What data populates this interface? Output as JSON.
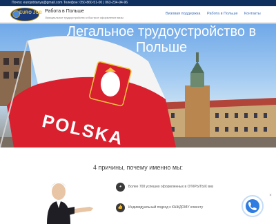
{
  "topbar": {
    "contacts": "Почта: eurojobtanya@gmail.com Телефон: 050-860-51-00 | 063-234-94-96"
  },
  "header": {
    "logo_text": "EURO JOB",
    "title": "Работа в Польше",
    "tagline": "Официальное трудоустройство и быстрое оформление визы"
  },
  "nav": {
    "items": [
      {
        "label": "Визовая поддержка"
      },
      {
        "label": "Работа в Польше"
      },
      {
        "label": "Контакты"
      }
    ]
  },
  "hero": {
    "title": "Легальное трудоустройство в Польше",
    "flag_text": "POLSKA"
  },
  "reasons": {
    "title": "4 причины, почему именно мы:",
    "items": [
      {
        "text": "Более 700 успешно оформленных в ОТКРЫТЫХ виз",
        "icon": "chart-icon"
      },
      {
        "text": "Индивидуальный подход к КАЖДОМУ клиенту",
        "icon": "thumbs-up-icon"
      }
    ]
  },
  "widget": {
    "close": "×",
    "icon": "phone-icon"
  },
  "colors": {
    "topbar": "#0f2f5e",
    "nav_link": "#3a6bb5",
    "flag_red": "#d8202e",
    "call_button": "#2f7de1"
  }
}
